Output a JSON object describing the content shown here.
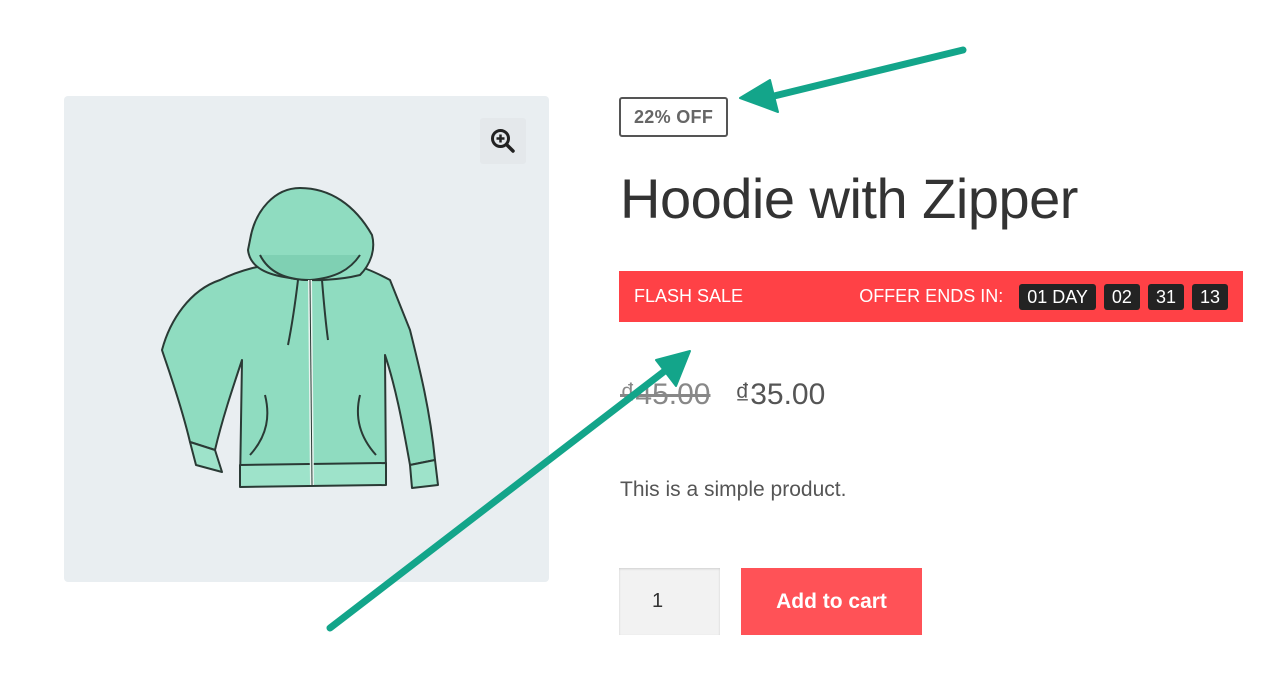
{
  "product": {
    "discount_badge": "22% OFF",
    "title": "Hoodie with Zipper",
    "old_price": "₫45.00",
    "new_price": "₫35.00",
    "description": "This is a simple product."
  },
  "flash_sale": {
    "label": "FLASH SALE",
    "ends_label": "OFFER ENDS IN:",
    "days": "01 DAY",
    "hours": "02",
    "minutes": "31",
    "seconds": "13"
  },
  "cart": {
    "quantity": "1",
    "button_label": "Add to cart"
  },
  "icons": {
    "zoom": "zoom-in-icon",
    "product_image": "hoodie-image"
  },
  "colors": {
    "flash_bar": "#ff4146",
    "cart_button": "#ff5257",
    "annotation_arrow": "#13a58a",
    "hoodie": "#8fdcc0"
  }
}
